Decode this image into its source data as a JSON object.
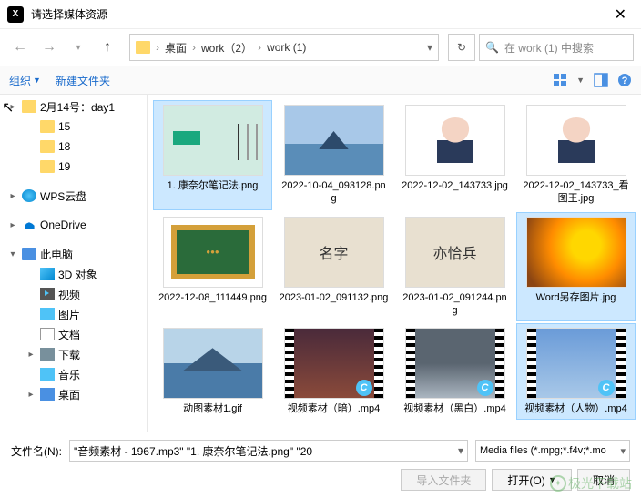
{
  "titlebar": {
    "title": "请选择媒体资源"
  },
  "breadcrumbs": [
    "桌面",
    "work（2）",
    "work (1)"
  ],
  "search": {
    "placeholder": "在 work (1) 中搜索"
  },
  "toolbar": {
    "organize": "组织",
    "new_folder": "新建文件夹"
  },
  "sidebar": {
    "items": [
      {
        "label": "2月14号：day1",
        "icon": "folder",
        "exp": "▸",
        "indent": 0
      },
      {
        "label": "15",
        "icon": "folder",
        "exp": "",
        "indent": 1
      },
      {
        "label": "18",
        "icon": "folder",
        "exp": "",
        "indent": 1
      },
      {
        "label": "19",
        "icon": "folder",
        "exp": "",
        "indent": 1
      },
      {
        "sep": true
      },
      {
        "label": "WPS云盘",
        "icon": "wps",
        "exp": "▸",
        "indent": 0
      },
      {
        "sep": true
      },
      {
        "label": "OneDrive",
        "icon": "onedrive",
        "exp": "▸",
        "indent": 0
      },
      {
        "sep": true
      },
      {
        "label": "此电脑",
        "icon": "pc",
        "exp": "▾",
        "indent": 0
      },
      {
        "label": "3D 对象",
        "icon": "obj3d",
        "exp": "",
        "indent": 1
      },
      {
        "label": "视频",
        "icon": "video",
        "exp": "",
        "indent": 1
      },
      {
        "label": "图片",
        "icon": "pict",
        "exp": "",
        "indent": 1
      },
      {
        "label": "文档",
        "icon": "doc",
        "exp": "",
        "indent": 1
      },
      {
        "label": "下载",
        "icon": "down",
        "exp": "▸",
        "indent": 1
      },
      {
        "label": "音乐",
        "icon": "music",
        "exp": "",
        "indent": 1
      },
      {
        "label": "桌面",
        "icon": "desk",
        "exp": "▸",
        "indent": 1
      }
    ]
  },
  "files": [
    {
      "name": "1. 康奈尔笔记法.png",
      "thumb": "img1",
      "selected": true
    },
    {
      "name": "2022-10-04_093128.png",
      "thumb": "img2",
      "selected": false
    },
    {
      "name": "2022-12-02_143733.jpg",
      "thumb": "img3",
      "selected": false
    },
    {
      "name": "2022-12-02_143733_看图王.jpg",
      "thumb": "img4",
      "selected": false
    },
    {
      "name": "2022-12-08_111449.png",
      "thumb": "img5",
      "selected": false
    },
    {
      "name": "2023-01-02_091132.png",
      "thumb": "img6",
      "selected": false,
      "inner": "名字"
    },
    {
      "name": "2023-01-02_091244.png",
      "thumb": "img7",
      "selected": false,
      "inner": "亦恰兵"
    },
    {
      "name": "Word另存图片.jpg",
      "thumb": "img8",
      "selected": true
    },
    {
      "name": "动图素材1.gif",
      "thumb": "img9",
      "selected": false
    },
    {
      "name": "视频素材（暗）.mp4",
      "thumb": "video",
      "vin": "city",
      "badge": "C",
      "selected": false
    },
    {
      "name": "视频素材（黑白）.mp4",
      "thumb": "video",
      "vin": "bw",
      "badge": "C",
      "selected": false
    },
    {
      "name": "视频素材（人物）.mp4",
      "thumb": "video",
      "vin": "sky",
      "badge": "C",
      "selected": true
    }
  ],
  "bottom": {
    "filename_label": "文件名(N):",
    "filename_value": "\"音频素材 - 1967.mp3\" \"1. 康奈尔笔记法.png\" \"20",
    "filter": "Media files (*.mpg;*.f4v;*.mo",
    "import_folder": "导入文件夹",
    "open": "打开(O)",
    "cancel": "取消"
  },
  "watermark": "极光下载站"
}
